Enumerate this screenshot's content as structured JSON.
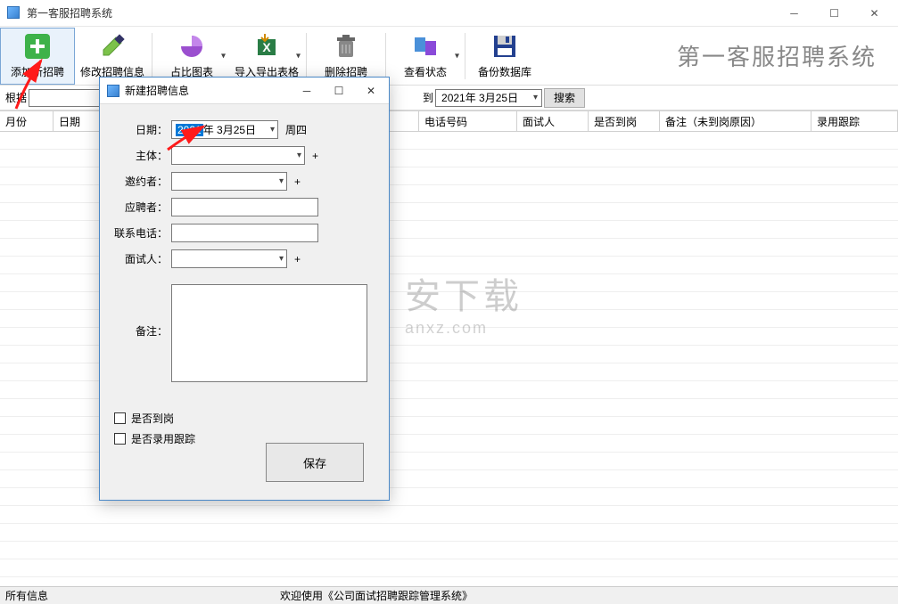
{
  "app": {
    "title": "第一客服招聘系统",
    "brand": "第一客服招聘系统"
  },
  "toolbar": {
    "add": "添加新招聘",
    "edit": "修改招聘信息",
    "chart": "占比图表",
    "import_export": "导入导出表格",
    "delete": "删除招聘",
    "status": "查看状态",
    "backup": "备份数据库"
  },
  "filter": {
    "label_root": "根据",
    "label_to": "到",
    "date_to": "2021年 3月25日",
    "search_btn": "搜索"
  },
  "columns": {
    "month": "月份",
    "date": "日期",
    "phone": "电话号码",
    "interviewer": "面试人",
    "arrived": "是否到岗",
    "remark": "备注（未到岗原因）",
    "track": "录用跟踪"
  },
  "dialog": {
    "title": "新建招聘信息",
    "labels": {
      "date": "日期：",
      "subject": "主体：",
      "inviter": "邀约者：",
      "applicant": "应聘者：",
      "phone": "联系电话：",
      "interviewer": "面试人：",
      "remark": "备注："
    },
    "date_year_sel": "2021",
    "date_rest": "年  3月25日",
    "weekday": "周四",
    "plus": "+",
    "chk_arrived": "是否到岗",
    "chk_track": "是否录用跟踪",
    "save": "保存"
  },
  "status": {
    "left": "所有信息",
    "center": "欢迎使用《公司面试招聘跟踪管理系统》"
  },
  "watermark": {
    "big": "安下载",
    "small": "anxz.com"
  }
}
